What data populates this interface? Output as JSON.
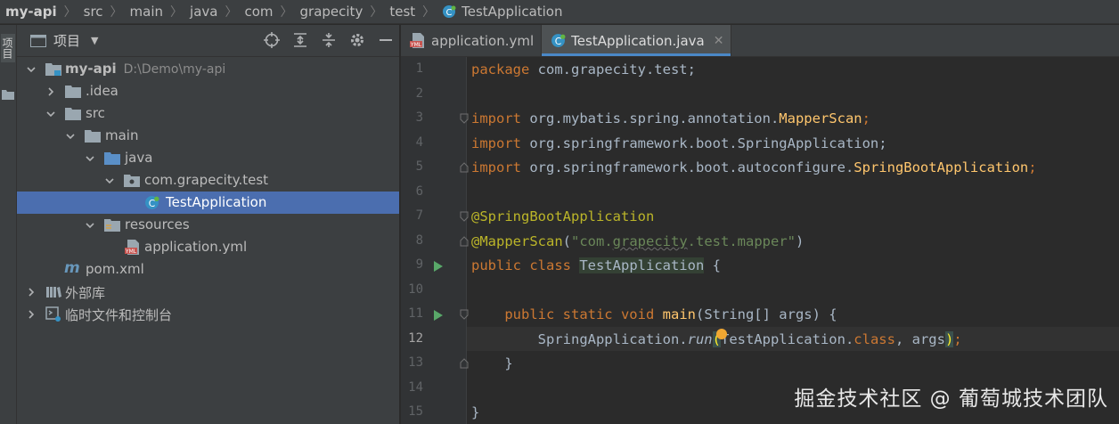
{
  "breadcrumb": {
    "items": [
      "my-api",
      "src",
      "main",
      "java",
      "com",
      "grapecity",
      "test",
      "TestApplication"
    ]
  },
  "toolstrip": {
    "label": "项目"
  },
  "project_panel": {
    "title": "项目",
    "tree": [
      {
        "label": "my-api",
        "path": "D:\\Demo\\my-api",
        "icon": "module-folder-icon",
        "expanded": true
      },
      {
        "label": ".idea",
        "icon": "folder-icon",
        "expanded": false
      },
      {
        "label": "src",
        "icon": "folder-icon",
        "expanded": true
      },
      {
        "label": "main",
        "icon": "folder-icon",
        "expanded": true
      },
      {
        "label": "java",
        "icon": "source-folder-icon",
        "expanded": true
      },
      {
        "label": "com.grapecity.test",
        "icon": "package-icon",
        "expanded": true
      },
      {
        "label": "TestApplication",
        "icon": "spring-class-icon",
        "selected": true
      },
      {
        "label": "resources",
        "icon": "resources-folder-icon",
        "expanded": true
      },
      {
        "label": "application.yml",
        "icon": "yml-file-icon"
      },
      {
        "label": "pom.xml",
        "icon": "maven-icon"
      },
      {
        "label": "外部库",
        "icon": "libraries-icon",
        "expanded": false
      },
      {
        "label": "临时文件和控制台",
        "icon": "scratches-icon",
        "expanded": false
      }
    ]
  },
  "editor": {
    "tabs": [
      {
        "label": "application.yml",
        "icon": "yml-file-icon",
        "active": false
      },
      {
        "label": "TestApplication.java",
        "icon": "spring-class-icon",
        "active": true
      }
    ],
    "line_numbers": [
      "1",
      "2",
      "3",
      "4",
      "5",
      "6",
      "7",
      "8",
      "9",
      "10",
      "11",
      "12",
      "13",
      "14",
      "15"
    ],
    "current_line": "12",
    "code": {
      "l1_kw": "package",
      "l1_rest": " com.grapecity.test;",
      "l3_kw": "import",
      "l3_pkg": " org.mybatis.spring.annotation.",
      "l3_cls": "MapperScan",
      "l3_end": ";",
      "l4_kw": "import",
      "l4_rest": " org.springframework.boot.SpringApplication;",
      "l5_kw": "import",
      "l5_pkg": " org.springframework.boot.autoconfigure.",
      "l5_cls": "SpringBootApplication",
      "l5_end": ";",
      "l7_ann": "@SpringBootApplication",
      "l8_ann": "@MapperScan",
      "l8_open": "(",
      "l8_str_a": "\"com.",
      "l8_str_b": "grapecity",
      "l8_str_c": ".test.mapper\"",
      "l8_close": ")",
      "l9_kw": "public class",
      "l9_space": " ",
      "l9_cls": "TestApplication",
      "l9_end": " {",
      "l11_indent": "    ",
      "l11_kw": "public static void",
      "l11_space": " ",
      "l11_fn": "main",
      "l11_rest": "(String[] args) {",
      "l12_indent": "        ",
      "l12_cls": "SpringApplication.",
      "l12_fn": "run",
      "l12_open": "(",
      "l12_mid": "TestApplication.",
      "l12_kw": "class",
      "l12_args": ", args",
      "l12_close": ")",
      "l12_end": ";",
      "l13_text": "    }",
      "l15_text": "}"
    }
  },
  "watermark": "掘金技术社区 @ 葡萄城技术团队"
}
